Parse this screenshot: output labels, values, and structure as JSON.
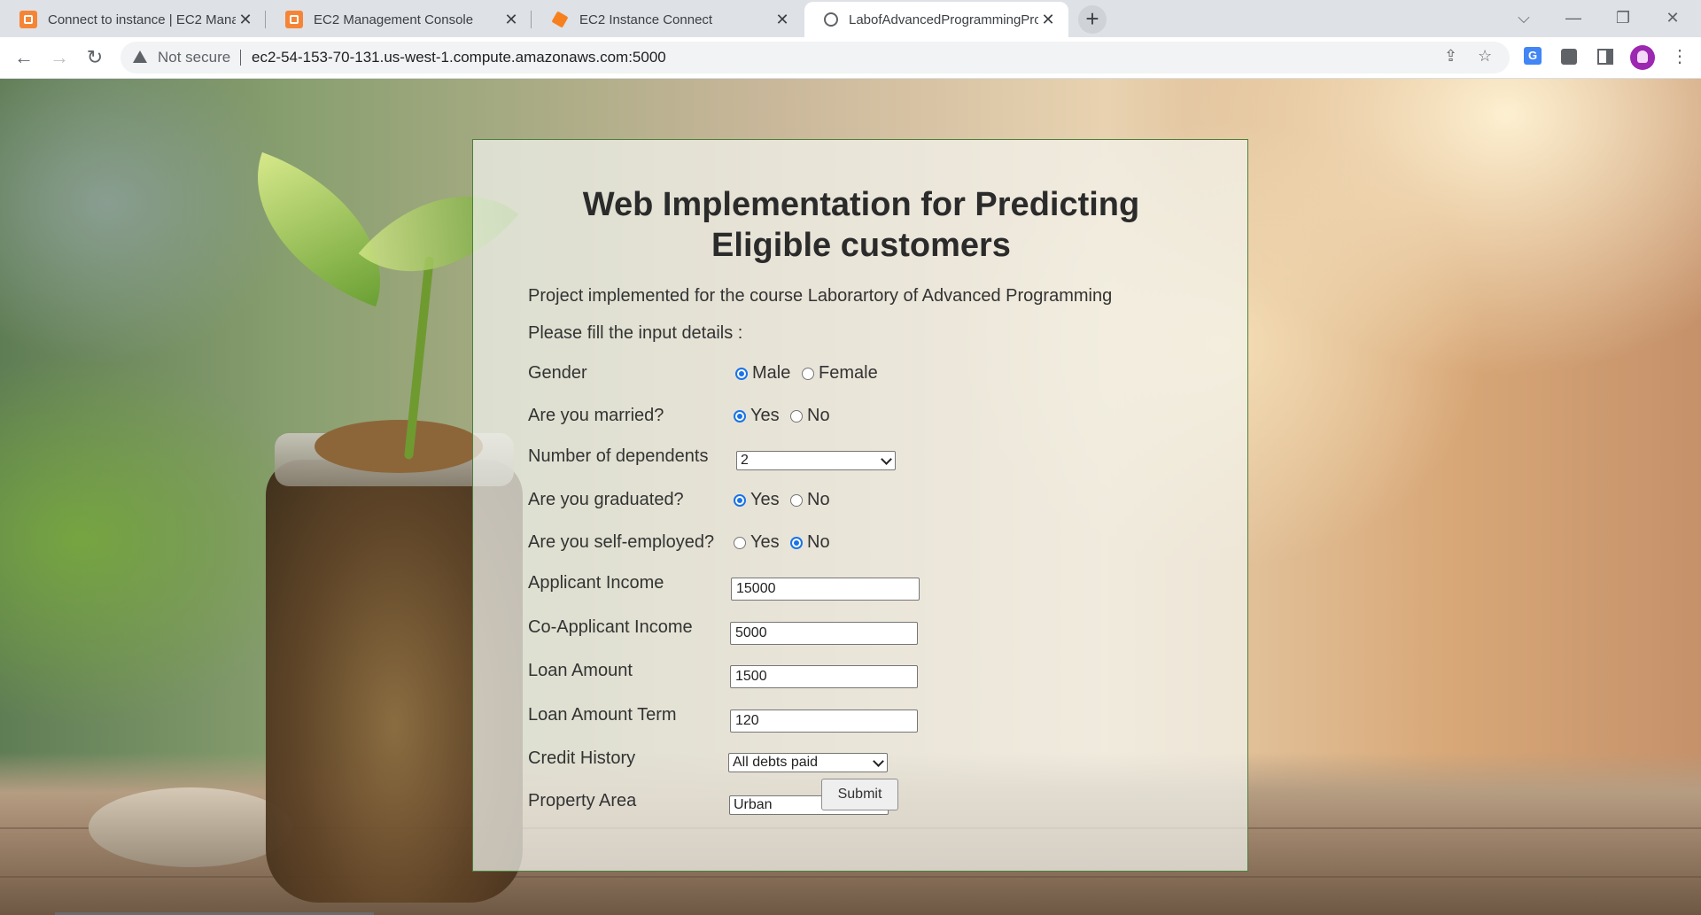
{
  "browser": {
    "tabs": [
      {
        "title": "Connect to instance | EC2 Manag",
        "icon": "aws-icon",
        "active": false
      },
      {
        "title": "EC2 Management Console",
        "icon": "aws-icon",
        "active": false
      },
      {
        "title": "EC2 Instance Connect",
        "icon": "cube-icon",
        "active": false
      },
      {
        "title": "LabofAdvancedProgrammingPro",
        "icon": "globe-icon",
        "active": true
      }
    ],
    "new_tab_label": "+",
    "security_label": "Not secure",
    "url": "ec2-54-153-70-131.us-west-1.compute.amazonaws.com:5000"
  },
  "page": {
    "title_line1": "Web Implementation for Predicting",
    "title_line2": "Eligible customers",
    "subtitle": "Project implemented for the course Laborartory of Advanced Programming",
    "instructions": "Please fill the input details :",
    "fields": {
      "gender": {
        "label": "Gender",
        "options": [
          "Male",
          "Female"
        ],
        "selected": "Male"
      },
      "married": {
        "label": "Are you married?",
        "options": [
          "Yes",
          "No"
        ],
        "selected": "Yes"
      },
      "dependents": {
        "label": "Number of dependents",
        "value": "2"
      },
      "graduated": {
        "label": "Are you graduated?",
        "options": [
          "Yes",
          "No"
        ],
        "selected": "Yes"
      },
      "self_employed": {
        "label": "Are you self-employed?",
        "options": [
          "Yes",
          "No"
        ],
        "selected": "No"
      },
      "applicant_income": {
        "label": "Applicant Income",
        "value": "15000"
      },
      "coapplicant_income": {
        "label": "Co-Applicant Income",
        "value": "5000"
      },
      "loan_amount": {
        "label": "Loan Amount",
        "value": "1500"
      },
      "loan_term": {
        "label": "Loan Amount Term",
        "value": "120"
      },
      "credit_history": {
        "label": "Credit History",
        "value": "All debts paid"
      },
      "property_area": {
        "label": "Property Area",
        "value": "Urban"
      }
    },
    "submit_label": "Submit"
  },
  "colors": {
    "panel_border": "#4d7f3b",
    "radio_checked": "#1a73e8"
  }
}
